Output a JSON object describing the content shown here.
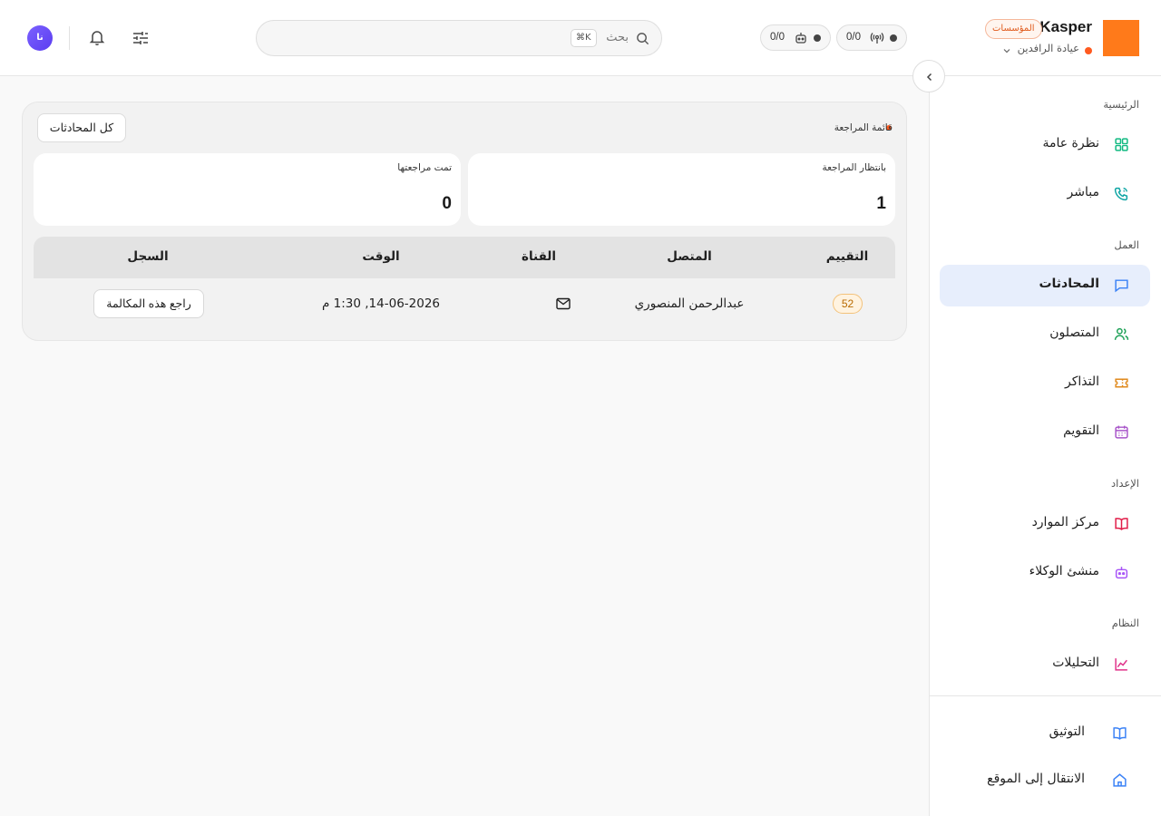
{
  "topbar": {
    "brand": "Kasper",
    "badge": "المؤسسات",
    "clinic": "عيادة الرافدين",
    "counters": [
      {
        "value": "0/0",
        "icon": "broadcast-icon"
      },
      {
        "value": "0/0",
        "icon": "robot-icon"
      }
    ],
    "search": {
      "placeholder": "بحث",
      "shortcut": "⌘K"
    },
    "avatar": "نا"
  },
  "sidebar": {
    "sections": [
      {
        "label": "الرئيسية"
      },
      {
        "label": "العمل"
      },
      {
        "label": "الإعداد"
      },
      {
        "label": "النظام"
      }
    ],
    "items": [
      {
        "label": "نظرة عامة",
        "icon": "grid-icon",
        "color": "#10b981"
      },
      {
        "label": "مباشر",
        "icon": "phone-icon",
        "color": "#0ea5a4"
      },
      {
        "label": "المحادثات",
        "icon": "chat-icon",
        "color": "#3b82f6",
        "active": true
      },
      {
        "label": "المتصلون",
        "icon": "users-icon",
        "color": "#22a35a"
      },
      {
        "label": "التذاكر",
        "icon": "ticket-icon",
        "color": "#e08a1e"
      },
      {
        "label": "التقويم",
        "icon": "calendar-icon",
        "color": "#a855c9"
      },
      {
        "label": "مركز الموارد",
        "icon": "book-icon",
        "color": "#e11d48"
      },
      {
        "label": "منشئ الوكلاء",
        "icon": "robot-icon",
        "color": "#a855f7"
      },
      {
        "label": "التحليلات",
        "icon": "chart-icon",
        "color": "#e0338a"
      }
    ],
    "footer": [
      {
        "label": "التوثيق",
        "icon": "book-open-icon",
        "color": "#3b82f6"
      },
      {
        "label": "الانتقال إلى الموقع",
        "icon": "home-icon",
        "color": "#3b82f6"
      }
    ]
  },
  "main": {
    "title": "قائمة المراجعة",
    "all_button": "كل المحادثات",
    "stats": [
      {
        "label": "بانتظار المراجعة",
        "value": "1"
      },
      {
        "label": "تمت مراجعتها",
        "value": "0"
      }
    ],
    "table": {
      "headers": [
        "التقييم",
        "المتصل",
        "القناة",
        "الوقت",
        "السجل"
      ],
      "rows": [
        {
          "score": "52",
          "caller": "عبدالرحمن المنصوري",
          "channel": "mail-icon",
          "time": "14-06-2026, 1:30 م",
          "action": "راجع هذه المكالمة"
        }
      ]
    }
  }
}
